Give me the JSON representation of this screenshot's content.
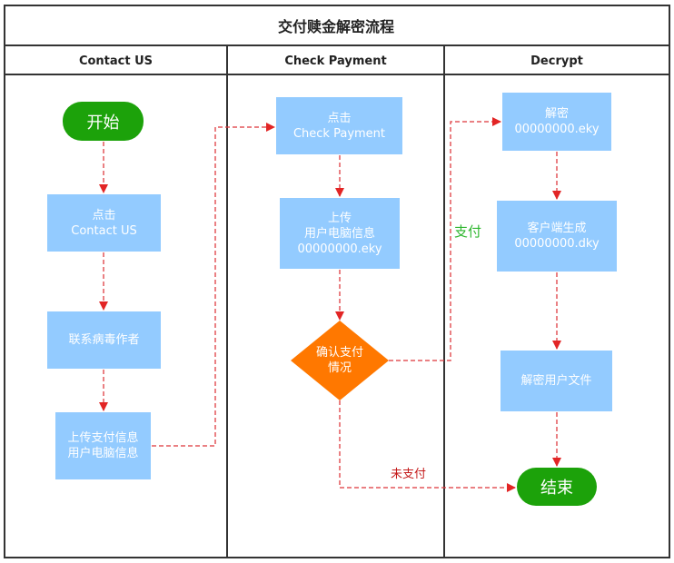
{
  "title": "交付赎金解密流程",
  "columns": [
    {
      "label": "Contact US"
    },
    {
      "label": "Check Payment"
    },
    {
      "label": "Decrypt"
    }
  ],
  "nodes": {
    "start": {
      "label": "开始"
    },
    "click_contact": {
      "line1": "点击",
      "line2": "Contact US"
    },
    "contact_author": {
      "label": "联系病毒作者"
    },
    "upload_payment_info": {
      "line1": "上传支付信息",
      "line2": "用户电脑信息"
    },
    "click_check_payment": {
      "line1": "点击",
      "line2": "Check Payment"
    },
    "upload_user_info": {
      "line1": "上传",
      "line2": "用户电脑信息",
      "line3": "00000000.eky"
    },
    "confirm_payment": {
      "line1": "确认支付",
      "line2": "情况"
    },
    "decrypt_eky": {
      "line1": "解密",
      "line2": "00000000.eky"
    },
    "client_generate": {
      "line1": "客户端生成",
      "line2": "00000000.dky"
    },
    "decrypt_files": {
      "label": "解密用户文件"
    },
    "end": {
      "label": "结束"
    }
  },
  "edge_labels": {
    "paid": "支付",
    "unpaid": "未支付"
  },
  "colors": {
    "process": "#93cbff",
    "terminal": "#1ca20a",
    "decision": "#ff7800",
    "connector": "#e0393e",
    "arrowhead": "#dd0000",
    "paid_label": "#2fb62f",
    "unpaid_label": "#c41a1a",
    "border": "#333333"
  }
}
